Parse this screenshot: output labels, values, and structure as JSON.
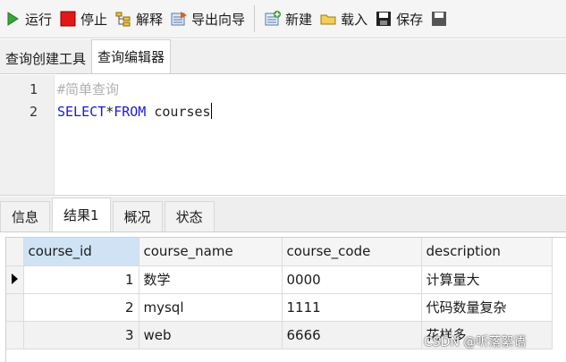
{
  "toolbar": {
    "run": "运行",
    "stop": "停止",
    "explain": "解释",
    "export_wizard": "导出向导",
    "new": "新建",
    "load": "载入",
    "save": "保存"
  },
  "editor_tabs": {
    "query_builder": "查询创建工具",
    "query_editor": "查询编辑器"
  },
  "editor": {
    "lines": [
      {
        "number": "1",
        "comment": "#简单查询"
      },
      {
        "number": "2",
        "kw1": "SELECT",
        "star": "*",
        "kw2": "FROM",
        "table": " courses"
      }
    ]
  },
  "result_tabs": [
    "信息",
    "结果1",
    "概况",
    "状态"
  ],
  "grid": {
    "columns": [
      "course_id",
      "course_name",
      "course_code",
      "description"
    ],
    "rows": [
      {
        "course_id": "1",
        "course_name": "数学",
        "course_code": "0000",
        "description": "计算量大"
      },
      {
        "course_id": "2",
        "course_name": "mysql",
        "course_code": "1111",
        "description": "代码数量复杂"
      },
      {
        "course_id": "3",
        "course_name": "web",
        "course_code": "6666",
        "description": "花样多"
      }
    ]
  },
  "watermark": "CSDN @听落絮语",
  "colors": {
    "keyword": "#1a1ad6",
    "comment": "#b0b0b0",
    "selected_header": "#cfe3f5"
  }
}
